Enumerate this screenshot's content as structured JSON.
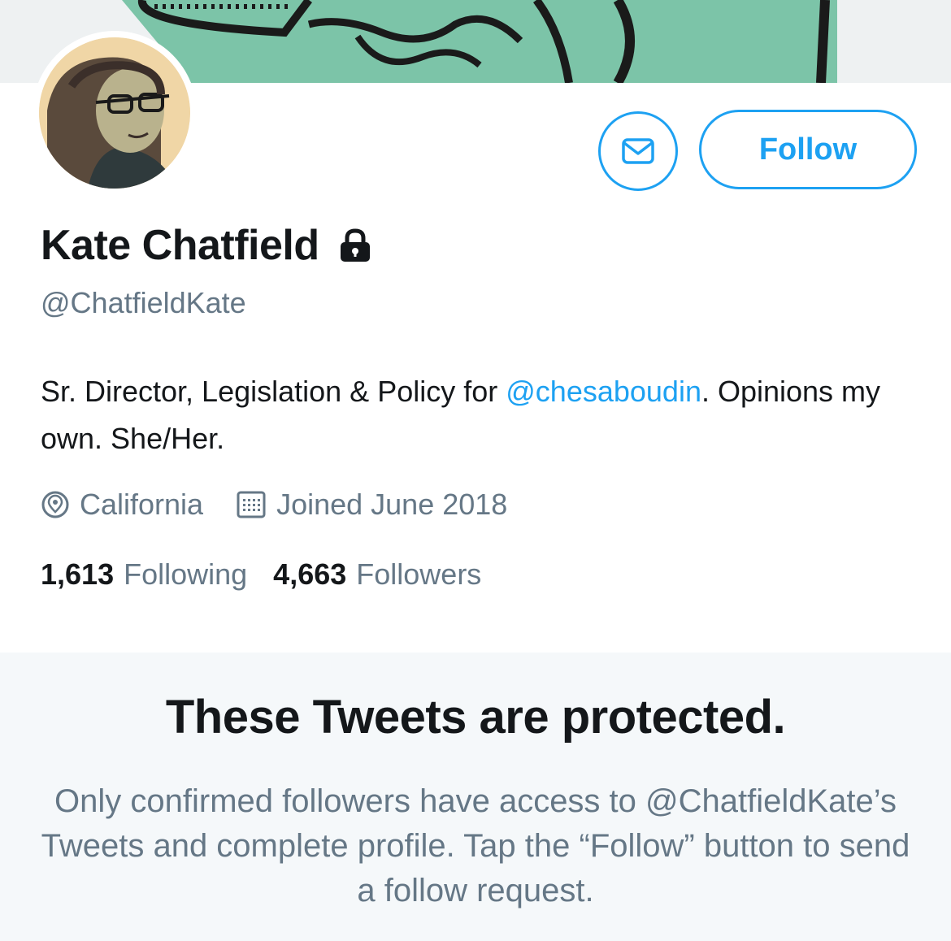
{
  "profile": {
    "name": "Kate Chatfield",
    "handle": "@ChatfieldKate",
    "bio_prefix": "Sr. Director, Legislation & Policy for ",
    "bio_mention": "@chesaboudin",
    "bio_suffix": ". Opinions my own. She/Her.",
    "location": "California",
    "joined": "Joined June 2018",
    "following_count": "1,613",
    "following_label": "Following",
    "followers_count": "4,663",
    "followers_label": "Followers",
    "protected_icon": "lock-icon"
  },
  "actions": {
    "follow_label": "Follow",
    "message_icon": "envelope-icon"
  },
  "protected_notice": {
    "title": "These Tweets are protected.",
    "body": "Only confirmed followers have access to @ChatfieldKate’s Tweets and complete profile. Tap the “Follow” button to send a follow request."
  },
  "colors": {
    "accent": "#1da1f2",
    "secondary_text": "#657786",
    "banner_green": "#7cc4a8"
  }
}
